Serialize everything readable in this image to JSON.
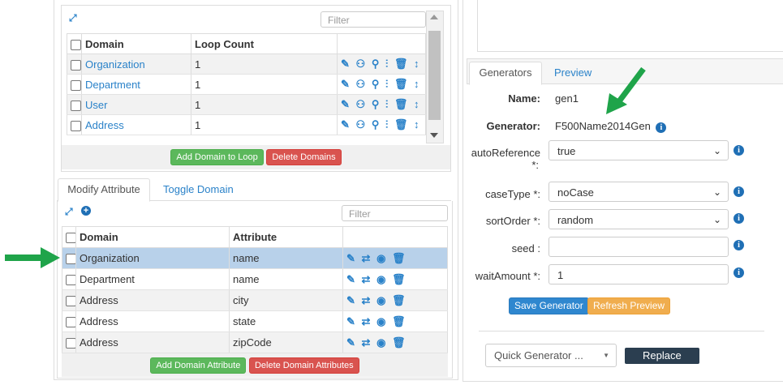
{
  "top_grid": {
    "filter_placeholder": "Filter",
    "headers": {
      "domain": "Domain",
      "loop_count": "Loop Count"
    },
    "rows": [
      {
        "domain": "Organization",
        "loop_count": "1"
      },
      {
        "domain": "Department",
        "loop_count": "1"
      },
      {
        "domain": "User",
        "loop_count": "1"
      },
      {
        "domain": "Address",
        "loop_count": "1"
      }
    ],
    "add_label": "Add Domain to Loop",
    "delete_label": "Delete Domains"
  },
  "attr_tabs": {
    "modify": "Modify Attribute",
    "toggle": "Toggle Domain"
  },
  "attr_grid": {
    "filter_placeholder": "Filter",
    "headers": {
      "domain": "Domain",
      "attribute": "Attribute"
    },
    "rows": [
      {
        "domain": "Organization",
        "attribute": "name"
      },
      {
        "domain": "Department",
        "attribute": "name"
      },
      {
        "domain": "Address",
        "attribute": "city"
      },
      {
        "domain": "Address",
        "attribute": "state"
      },
      {
        "domain": "Address",
        "attribute": "zipCode"
      }
    ],
    "add_label": "Add Domain Attribute",
    "delete_label": "Delete Domain Attributes"
  },
  "gen_tabs": {
    "generators": "Generators",
    "preview": "Preview"
  },
  "generator": {
    "name_label": "Name:",
    "name_value": "gen1",
    "generator_label": "Generator:",
    "generator_value": "F500Name2014Gen",
    "fields": [
      {
        "label": "autoReference",
        "label2": "*:",
        "value": "true"
      },
      {
        "label": "caseType *:",
        "value": "noCase"
      },
      {
        "label": "sortOrder *:",
        "value": "random"
      },
      {
        "label": "seed :",
        "value": ""
      },
      {
        "label": "waitAmount *:",
        "value": "1"
      }
    ],
    "save_label": "Save Generator",
    "refresh_label": "Refresh Preview",
    "quick_label": "Quick Generator ...",
    "replace_label": "Replace"
  },
  "colors": {
    "arrow": "#1fa44a",
    "selected_row": "#b8d1ea",
    "link": "#2a82c9"
  }
}
